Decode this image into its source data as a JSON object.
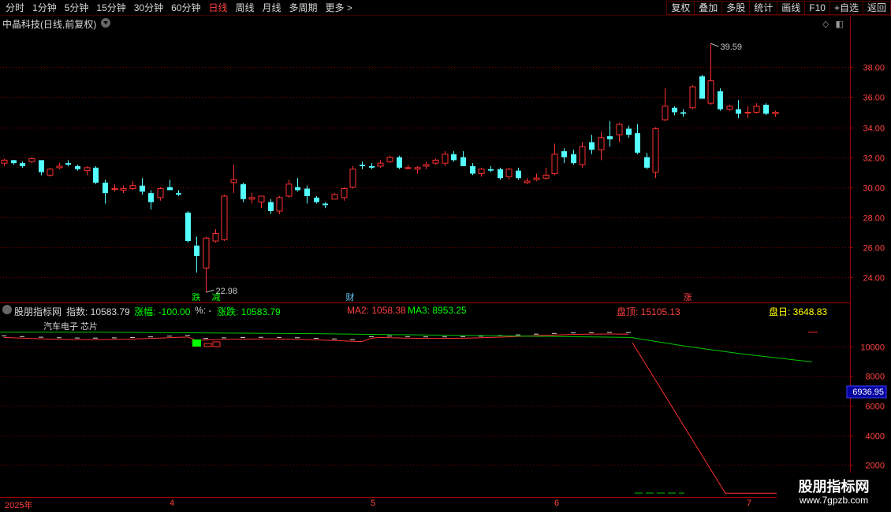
{
  "toolbar": {
    "periods": [
      {
        "label": "分时",
        "active": false
      },
      {
        "label": "1分钟",
        "active": false
      },
      {
        "label": "5分钟",
        "active": false
      },
      {
        "label": "15分钟",
        "active": false
      },
      {
        "label": "30分钟",
        "active": false
      },
      {
        "label": "60分钟",
        "active": false
      },
      {
        "label": "日线",
        "active": true
      },
      {
        "label": "周线",
        "active": false
      },
      {
        "label": "月线",
        "active": false
      },
      {
        "label": "多周期",
        "active": false
      },
      {
        "label": "更多 >",
        "active": false
      }
    ],
    "buttons": [
      "复权",
      "叠加",
      "多股",
      "统计",
      "画线",
      "F10",
      "+自选",
      "返回"
    ]
  },
  "main_chart": {
    "title": "中晶科技(日线,前复权)",
    "high_label": "39.59",
    "low_label": "22.98",
    "y_ticks": [
      "38.00",
      "36.00",
      "34.00",
      "32.00",
      "30.00",
      "28.00",
      "26.00",
      "24.00"
    ],
    "markers": [
      {
        "text": "跌",
        "color": "#00ff00"
      },
      {
        "text": "减",
        "color": "#00ff00"
      },
      {
        "text": "财",
        "color": "#66ccff"
      },
      {
        "text": "涨",
        "color": "#ff4040"
      }
    ]
  },
  "chart_data": {
    "type": "candlestick",
    "ylim": [
      22.3,
      40.6
    ],
    "candles": [
      [
        31.6,
        31.9,
        31.4,
        31.8
      ],
      [
        31.8,
        31.8,
        31.5,
        31.6
      ],
      [
        31.6,
        31.7,
        31.3,
        31.4
      ],
      [
        31.7,
        32.0,
        31.6,
        31.9
      ],
      [
        31.8,
        31.8,
        30.8,
        31.0
      ],
      [
        30.8,
        31.3,
        30.7,
        31.2
      ],
      [
        31.3,
        31.6,
        31.2,
        31.4
      ],
      [
        31.6,
        31.8,
        31.4,
        31.5
      ],
      [
        31.4,
        31.5,
        31.1,
        31.2
      ],
      [
        31.1,
        31.4,
        30.8,
        31.3
      ],
      [
        31.3,
        31.4,
        30.2,
        30.3
      ],
      [
        30.3,
        30.5,
        28.9,
        29.6
      ],
      [
        29.9,
        30.2,
        29.7,
        29.9
      ],
      [
        29.8,
        30.1,
        29.6,
        29.9
      ],
      [
        29.9,
        30.4,
        29.8,
        30.1
      ],
      [
        30.1,
        30.6,
        29.5,
        29.7
      ],
      [
        29.6,
        29.8,
        28.5,
        29.0
      ],
      [
        29.3,
        30.0,
        29.1,
        29.9
      ],
      [
        30.0,
        30.5,
        29.9,
        29.8
      ],
      [
        29.6,
        29.8,
        29.4,
        29.5
      ],
      [
        28.3,
        28.4,
        26.3,
        26.4
      ],
      [
        26.1,
        26.7,
        24.3,
        25.4
      ],
      [
        24.6,
        26.7,
        22.98,
        26.6
      ],
      [
        26.4,
        27.2,
        26.3,
        26.9
      ],
      [
        26.5,
        29.5,
        26.4,
        29.4
      ],
      [
        30.3,
        31.5,
        29.6,
        30.5
      ],
      [
        30.2,
        30.3,
        29.0,
        29.2
      ],
      [
        29.2,
        29.6,
        28.9,
        29.3
      ],
      [
        29.0,
        29.4,
        28.6,
        29.4
      ],
      [
        29.0,
        29.2,
        28.2,
        28.4
      ],
      [
        28.4,
        29.4,
        28.2,
        29.3
      ],
      [
        29.4,
        30.5,
        29.3,
        30.2
      ],
      [
        30.0,
        30.6,
        29.7,
        29.8
      ],
      [
        29.9,
        30.1,
        28.9,
        29.4
      ],
      [
        29.3,
        29.4,
        28.9,
        29.0
      ],
      [
        28.9,
        29.0,
        28.6,
        28.8
      ],
      [
        29.2,
        29.6,
        29.2,
        29.5
      ],
      [
        29.3,
        30.0,
        29.1,
        29.9
      ],
      [
        30.0,
        31.4,
        29.9,
        31.2
      ],
      [
        31.5,
        31.7,
        31.2,
        31.4
      ],
      [
        31.4,
        31.6,
        31.2,
        31.3
      ],
      [
        31.4,
        31.8,
        31.3,
        31.6
      ],
      [
        31.7,
        32.1,
        31.6,
        32.0
      ],
      [
        32.0,
        32.1,
        31.2,
        31.3
      ],
      [
        31.3,
        31.5,
        31.2,
        31.3
      ],
      [
        31.2,
        31.4,
        30.9,
        31.3
      ],
      [
        31.4,
        31.7,
        31.2,
        31.5
      ],
      [
        31.6,
        31.9,
        31.5,
        31.8
      ],
      [
        31.6,
        32.4,
        31.4,
        32.2
      ],
      [
        32.2,
        32.4,
        31.7,
        31.8
      ],
      [
        32.0,
        32.4,
        31.4,
        31.4
      ],
      [
        31.4,
        31.6,
        30.8,
        30.9
      ],
      [
        30.9,
        31.3,
        30.7,
        31.2
      ],
      [
        31.2,
        31.4,
        31.0,
        31.1
      ],
      [
        31.2,
        31.3,
        30.5,
        30.6
      ],
      [
        30.7,
        31.3,
        30.5,
        31.2
      ],
      [
        31.1,
        31.3,
        30.5,
        30.6
      ],
      [
        30.3,
        30.6,
        30.2,
        30.4
      ],
      [
        30.5,
        30.9,
        30.4,
        30.6
      ],
      [
        30.6,
        31.3,
        30.5,
        30.8
      ],
      [
        30.9,
        32.9,
        30.8,
        32.2
      ],
      [
        32.4,
        32.6,
        31.6,
        32.0
      ],
      [
        32.2,
        32.5,
        31.5,
        31.6
      ],
      [
        31.5,
        33.0,
        31.3,
        32.7
      ],
      [
        33.0,
        33.5,
        32.2,
        32.5
      ],
      [
        32.5,
        33.7,
        31.8,
        33.3
      ],
      [
        33.4,
        34.4,
        32.7,
        33.2
      ],
      [
        33.5,
        34.3,
        33.0,
        34.2
      ],
      [
        33.9,
        34.1,
        33.3,
        33.5
      ],
      [
        33.6,
        34.2,
        32.2,
        32.3
      ],
      [
        32.0,
        32.3,
        31.2,
        31.3
      ],
      [
        31.0,
        34.0,
        30.6,
        33.9
      ],
      [
        34.5,
        36.6,
        34.4,
        35.4
      ],
      [
        35.3,
        35.4,
        34.8,
        35.0
      ],
      [
        35.0,
        35.2,
        34.7,
        34.9
      ],
      [
        35.3,
        36.8,
        35.2,
        36.7
      ],
      [
        37.4,
        37.5,
        36.1,
        35.9
      ],
      [
        35.6,
        39.59,
        35.5,
        37.1
      ],
      [
        36.4,
        36.6,
        35.1,
        35.2
      ],
      [
        35.2,
        35.5,
        35.1,
        35.4
      ],
      [
        35.2,
        35.8,
        34.6,
        34.9
      ],
      [
        35.0,
        35.4,
        34.6,
        35.0
      ],
      [
        35.0,
        35.6,
        34.9,
        35.4
      ],
      [
        35.5,
        35.6,
        34.8,
        34.9
      ],
      [
        34.9,
        35.1,
        34.7,
        35.0
      ]
    ]
  },
  "sub_chart": {
    "legend": {
      "name": "股朋指标网",
      "index": "指数: 10583.79",
      "change_pct": "涨幅: -100.00",
      "pct": "%: -",
      "up_down": "涨跌: 10583.79",
      "ma2": "MA2: 1058.38",
      "ma3": "MA3: 8953.25",
      "peak": "盘顶: 15105.13",
      "day": "盘日: 3648.83"
    },
    "inline_text": "汽车电子 芯片",
    "y_ticks": [
      "10000",
      "8000",
      "6000",
      "4000",
      "2000"
    ],
    "current_value": "6936.95"
  },
  "x_axis": {
    "labels": [
      "2025年",
      "4",
      "5",
      "6",
      "7"
    ]
  },
  "watermark": {
    "title": "股朋指标网",
    "url": "www.7gpzb.com"
  },
  "colors": {
    "up": "#ff3030",
    "down": "#54ffff",
    "grid": "#8b0000",
    "axis_text": "#ff4040",
    "ma_line": "#00c800"
  }
}
